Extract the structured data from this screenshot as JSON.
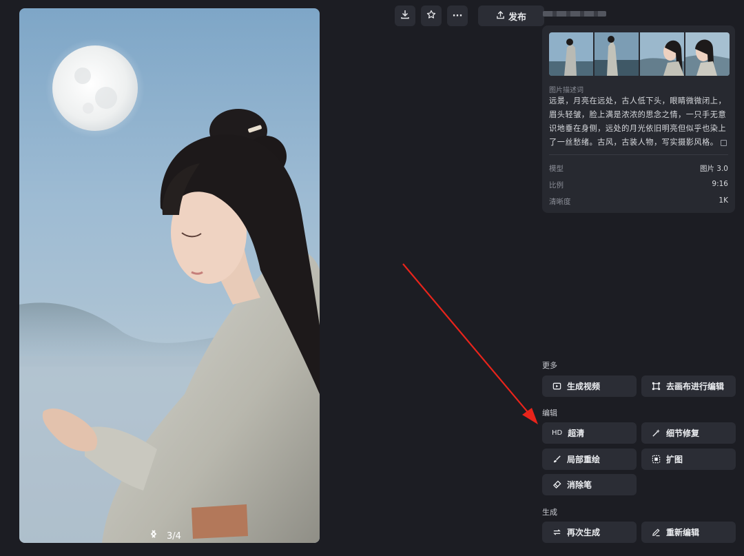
{
  "toolbar": {
    "download_icon": "download-icon",
    "favorite_icon": "star-icon",
    "more_icon": "more-icon",
    "more_label": "···",
    "publish_label": "发布"
  },
  "viewer": {
    "page_indicator": "3/4"
  },
  "info": {
    "desc_label": "图片描述词",
    "description": "远景，月亮在远处，古人低下头，眼睛微微闭上，眉头轻皱，脸上满是浓浓的思念之情，一只手无意识地垂在身侧，远处的月光依旧明亮但似乎也染上了一丝愁绪。古风，古装人物，写实摄影风格。",
    "model_label": "模型",
    "model_value": "图片 3.0",
    "ratio_label": "比例",
    "ratio_value": "9:16",
    "clarity_label": "清晰度",
    "clarity_value": "1K"
  },
  "more_section": {
    "label": "更多",
    "generate_video": "生成视频",
    "canvas_edit": "去画布进行编辑"
  },
  "edit_section": {
    "label": "编辑",
    "hd_icon_text": "HD",
    "super_res": "超清",
    "detail_repair": "细节修复",
    "inpaint": "局部重绘",
    "expand": "扩图",
    "eraser": "消除笔"
  },
  "generate_section": {
    "label": "生成",
    "regenerate": "再次生成",
    "re_edit": "重新编辑"
  },
  "colors": {
    "background": "#1c1d23",
    "button": "#2b2d35",
    "card": "#272930",
    "annotation_arrow": "#e8241b"
  }
}
